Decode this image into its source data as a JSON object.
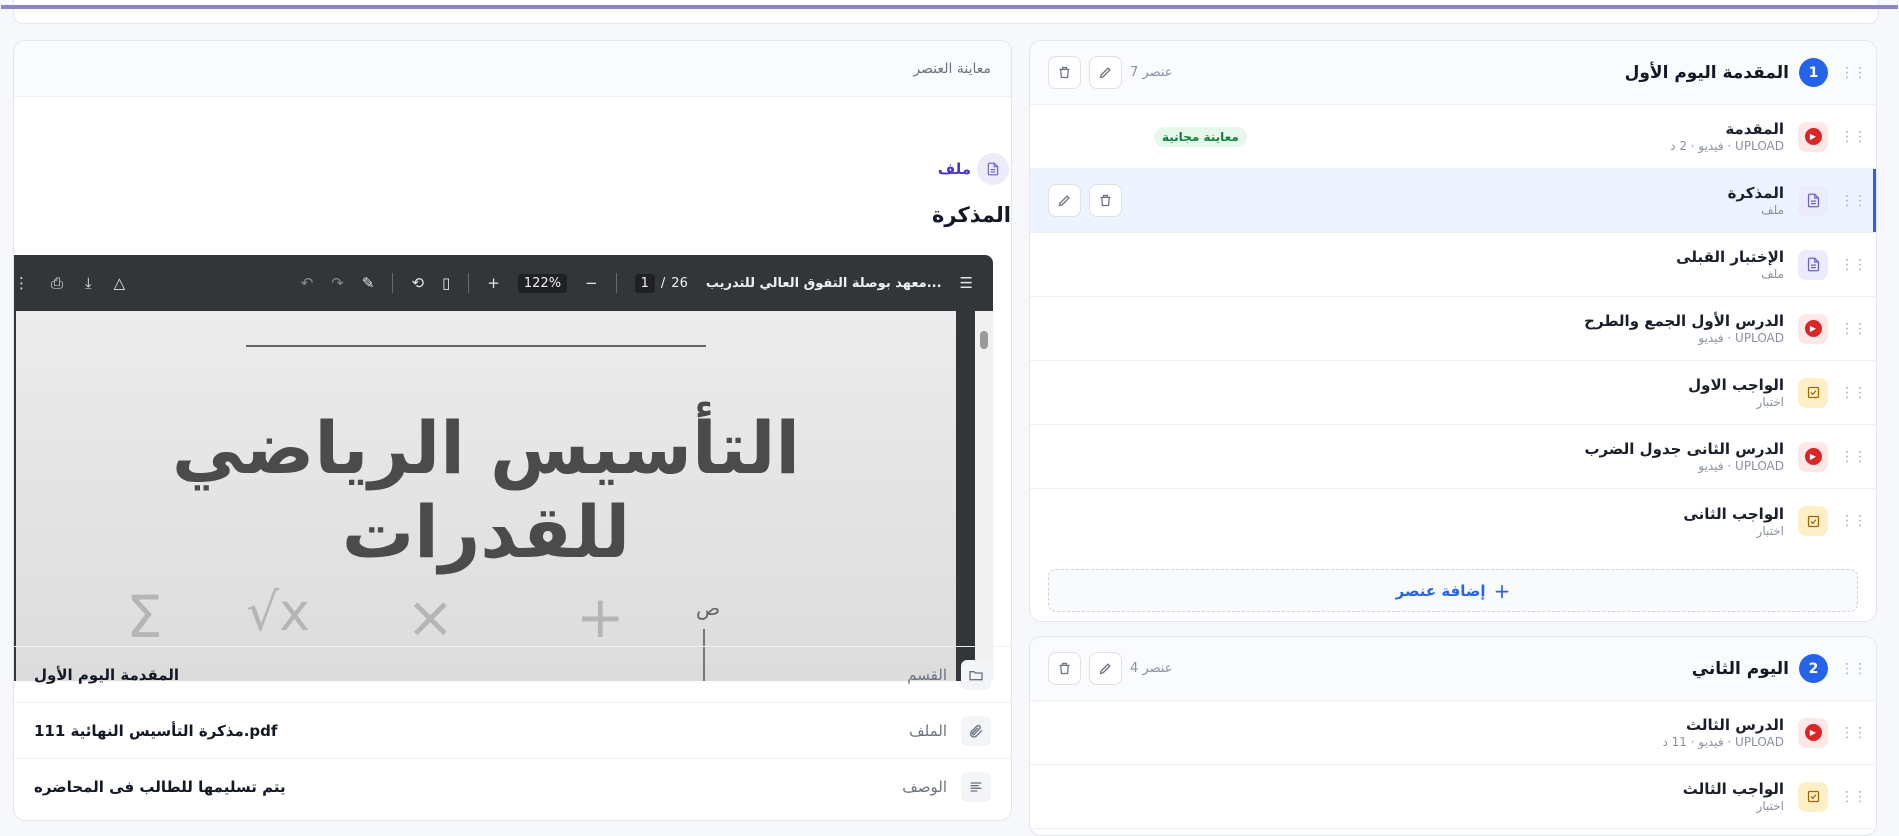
{
  "preview": {
    "header": "معاينة العنصر",
    "type_label": "ملف",
    "title": "المذكرة",
    "pdf": {
      "doc_title": "معهد بوصلة التفوق العالي للتدريب...",
      "page_current": "1",
      "page_total": "26",
      "zoom": "122%",
      "cover_title": "التأسيس الرياضي للقدرات",
      "cover_label": "ص"
    },
    "meta": [
      {
        "label": "القسم",
        "value": "المقدمة اليوم الأول",
        "icon": "folder-icon"
      },
      {
        "label": "الملف",
        "value": "مذكرة التأسيس النهائية 111.pdf",
        "icon": "paperclip-icon"
      },
      {
        "label": "الوصف",
        "value": "يتم تسليمها للطالب فى المحاضره",
        "icon": "text-lines-icon"
      }
    ]
  },
  "sections": [
    {
      "num": "1",
      "title": "المقدمة اليوم الأول",
      "count": "7 عنصر",
      "items": [
        {
          "title": "المقدمة",
          "sub": "فيديو · 2 د · UPLOAD",
          "type": "video",
          "badge": "معاينة مجانية"
        },
        {
          "title": "المذكرة",
          "sub": "ملف",
          "type": "file",
          "active": true
        },
        {
          "title": "الإختبار القبلى",
          "sub": "ملف",
          "type": "file"
        },
        {
          "title": "الدرس الأول الجمع والطرح",
          "sub": "فيديو · UPLOAD",
          "type": "video"
        },
        {
          "title": "الواجب الاول",
          "sub": "اختبار",
          "type": "quiz"
        },
        {
          "title": "الدرس الثانى جدول الضرب",
          "sub": "فيديو · UPLOAD",
          "type": "video"
        },
        {
          "title": "الواجب الثانى",
          "sub": "اختبار",
          "type": "quiz"
        }
      ],
      "add_label": "إضافة عنصر"
    },
    {
      "num": "2",
      "title": "اليوم الثاني",
      "count": "4 عنصر",
      "items": [
        {
          "title": "الدرس الثالث",
          "sub": "فيديو · 11 د · UPLOAD",
          "type": "video"
        },
        {
          "title": "الواجب الثالث",
          "sub": "اختبار",
          "type": "quiz"
        }
      ]
    }
  ],
  "colors": {
    "accent": "#2563eb",
    "video": "#dc2626",
    "free_badge": "#15803d"
  }
}
